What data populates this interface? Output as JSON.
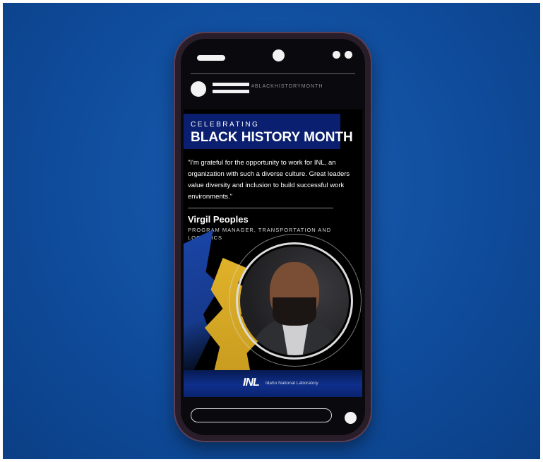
{
  "post": {
    "handle": "#BLACKHISTORYMONTH",
    "kicker": "CELEBRATING",
    "headline": "BLACK HISTORY MONTH",
    "quote": "\"I'm grateful for the opportunity to work for INL, an organization with such a diverse culture. Great leaders value diversity and inclusion to build successful work environments.\"",
    "name": "Virgil Peoples",
    "role": "PROGRAM MANAGER, TRANSPORTATION AND LOGISTICS",
    "logo_text": "INL",
    "logo_subtext": "Idaho National Laboratory"
  },
  "colors": {
    "background": "#0f4c9c",
    "banner": "#0b1f70",
    "gold": "#e0b22a",
    "blue": "#1a46a8"
  },
  "icons": {
    "status_bar": "status-bar-icon",
    "camera": "camera-icon",
    "dots": "more-dots-icon",
    "home": "home-indicator-icon"
  }
}
